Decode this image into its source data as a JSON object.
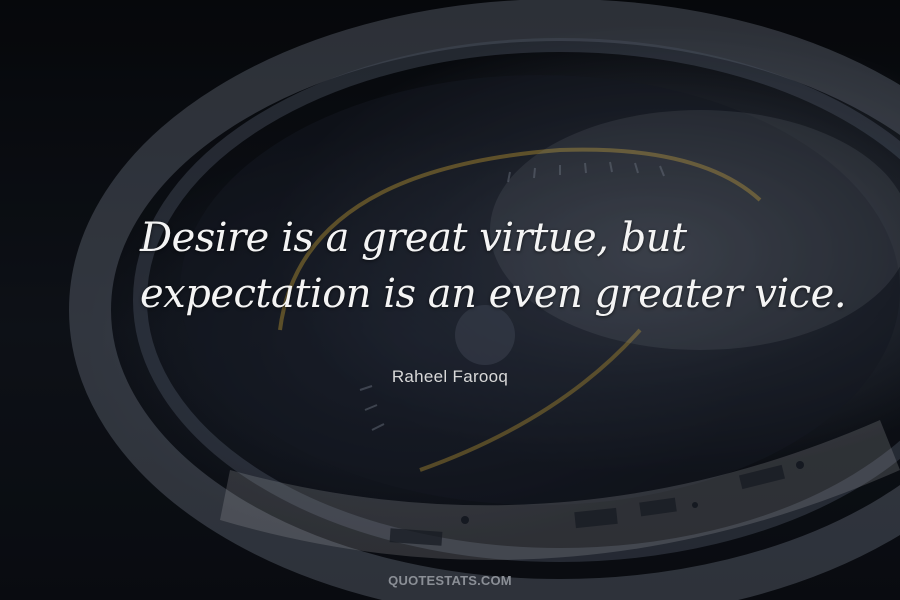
{
  "quote": {
    "line1": "Desire is a great virtue, but",
    "line2": "expectation is an even greater vice."
  },
  "author": "Raheel Farooq",
  "watermark": "QUOTESTATS.COM",
  "colors": {
    "background": "#0d0f14",
    "quote_text": "#f4f4f4",
    "author_text": "#d8d8d8",
    "watermark_text": "#8b8f96",
    "accent_ring": "#c8a23a"
  }
}
